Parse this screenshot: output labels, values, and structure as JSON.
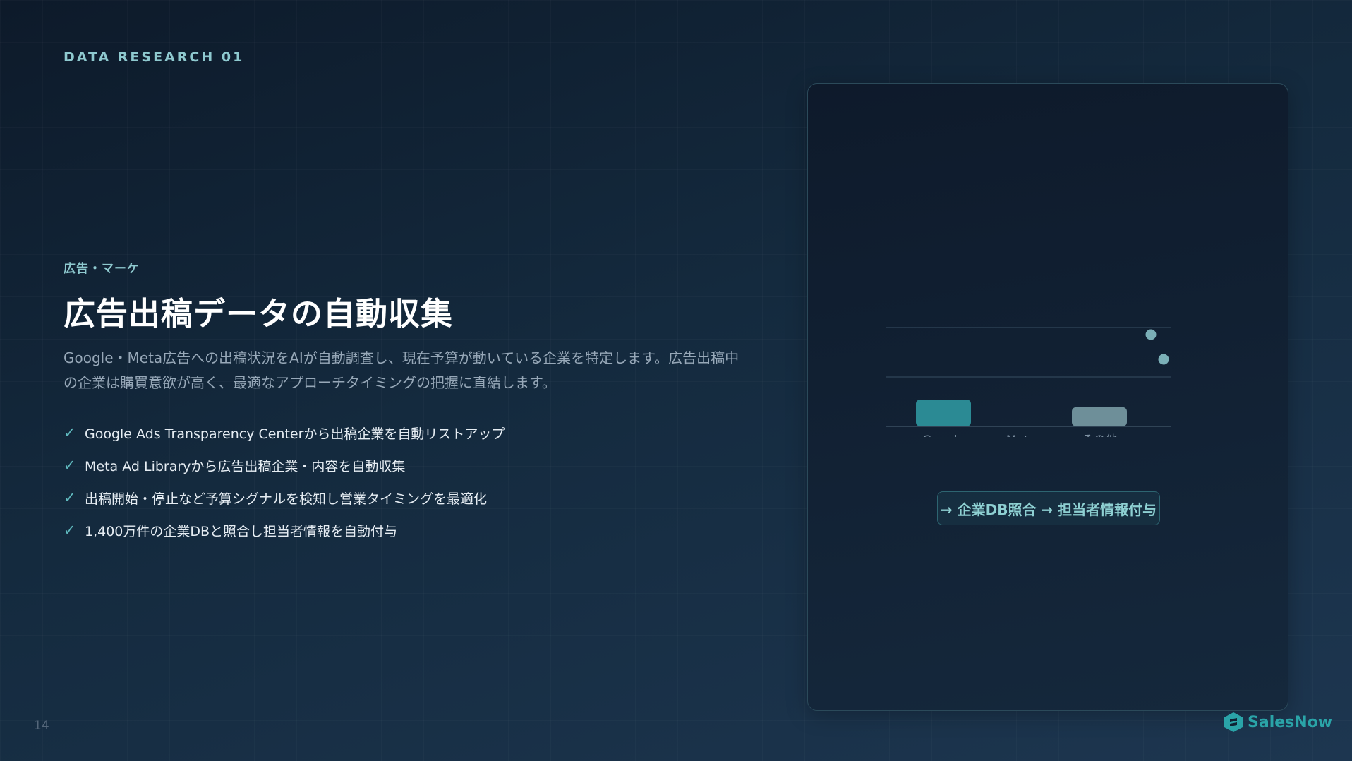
{
  "header": {
    "section_label": "DATA RESEARCH 01"
  },
  "content": {
    "category": "広告・マーケ",
    "title": "広告出稿データの自動収集",
    "description": "Google・Meta広告への出稿状況をAIが自動調査し、現在予算が動いている企業を特定します。広告出稿中の企業は購買意欲が高く、最適なアプローチタイミングの把握に直結します。",
    "check_icon": "✓",
    "features": [
      "Google Ads Transparency Centerから出稿企業を自動リストアップ",
      "Meta Ad Libraryから広告出稿企業・内容を自動収集",
      "出稿開始・停止など予算シグナルを検知し営業タイミングを最適化",
      "1,400万件の企業DBと照合し担当者情報を自動付与"
    ]
  },
  "chart_data": {
    "type": "bar",
    "categories": [
      "Google",
      "Meta",
      "その他"
    ],
    "values": [
      0.95,
      0.0,
      0.68
    ],
    "colors": [
      "#2b8a94",
      "#2b8a94",
      "#6e8f99"
    ],
    "grid": true,
    "dot_color": "#8ec9cf"
  },
  "flow": {
    "label": "→ 企業DB照合 → 担当者情報付与"
  },
  "footer": {
    "page_number": "14",
    "logo_text": "SalesNow",
    "logo_icon": "salesnow-hexagon-icon",
    "brand_color": "#2aa4a8"
  },
  "colors": {
    "accent": "#8ec9cf",
    "background_top": "#0d1a2a",
    "background_bottom": "#1d3650"
  }
}
